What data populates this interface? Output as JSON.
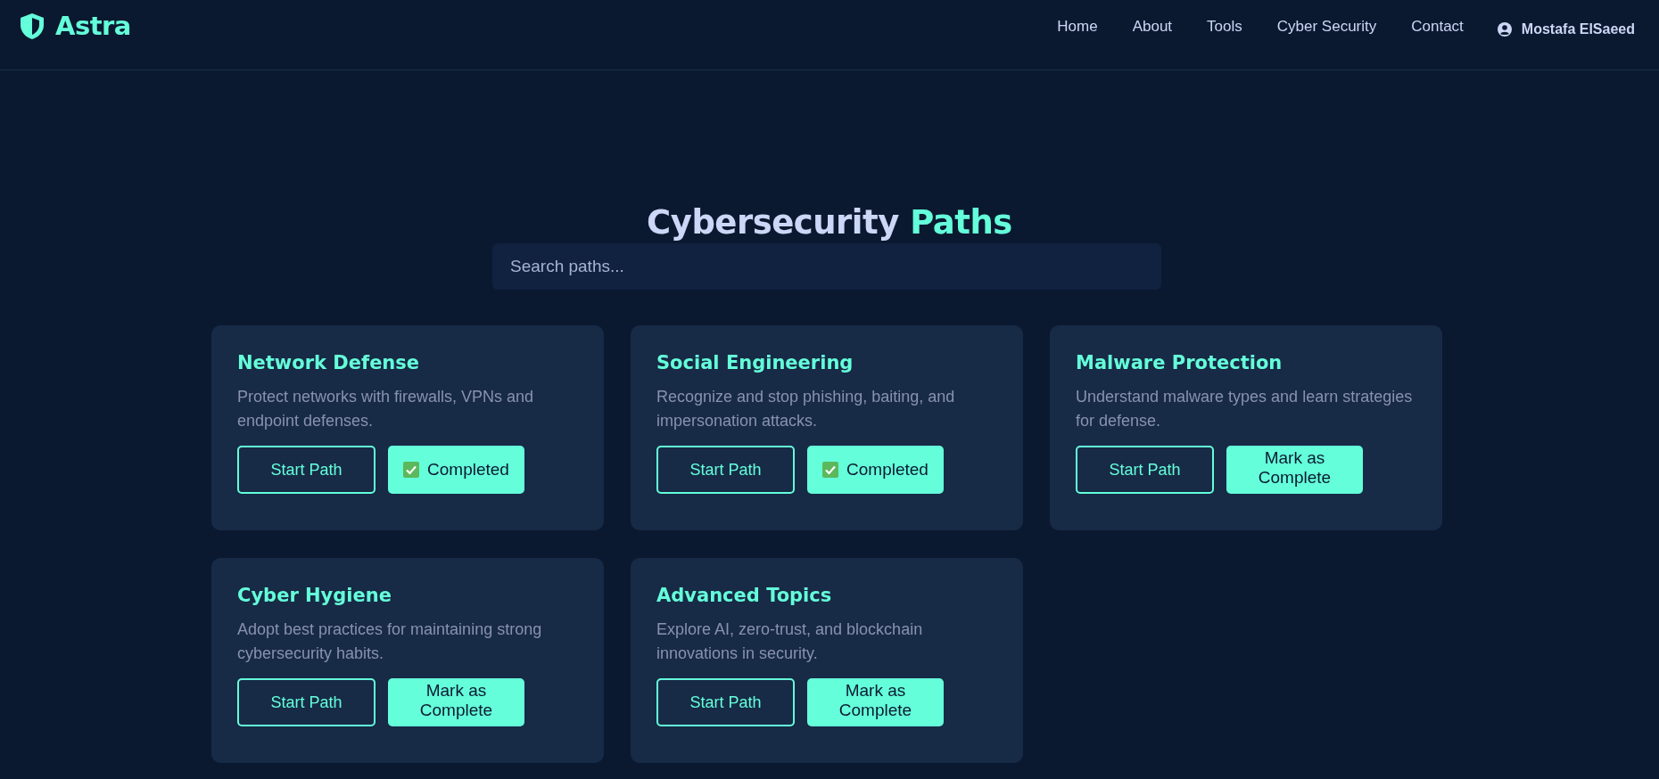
{
  "brand": {
    "name": "Astra"
  },
  "nav": {
    "links": [
      {
        "label": "Home"
      },
      {
        "label": "About"
      },
      {
        "label": "Tools"
      },
      {
        "label": "Cyber Security"
      },
      {
        "label": "Contact"
      }
    ],
    "user": "Mostafa ElSaeed"
  },
  "heading": {
    "text": "Cybersecurity",
    "highlight": "Paths"
  },
  "search": {
    "placeholder": "Search paths..."
  },
  "paths": [
    {
      "title": "Network Defense",
      "description": "Protect networks with firewalls, VPNs and endpoint defenses.",
      "start_label": "Start Path",
      "completed": true,
      "action_label": "Completed"
    },
    {
      "title": "Social Engineering",
      "description": "Recognize and stop phishing, baiting, and impersonation attacks.",
      "start_label": "Start Path",
      "completed": true,
      "action_label": "Completed"
    },
    {
      "title": "Malware Protection",
      "description": "Understand malware types and learn strategies for defense.",
      "start_label": "Start Path",
      "completed": false,
      "action_label": "Mark as Complete"
    },
    {
      "title": "Cyber Hygiene",
      "description": "Adopt best practices for maintaining strong cybersecurity habits.",
      "start_label": "Start Path",
      "completed": false,
      "action_label": "Mark as Complete"
    },
    {
      "title": "Advanced Topics",
      "description": "Explore AI, zero-trust, and blockchain innovations in security.",
      "start_label": "Start Path",
      "completed": false,
      "action_label": "Mark as Complete"
    }
  ]
}
